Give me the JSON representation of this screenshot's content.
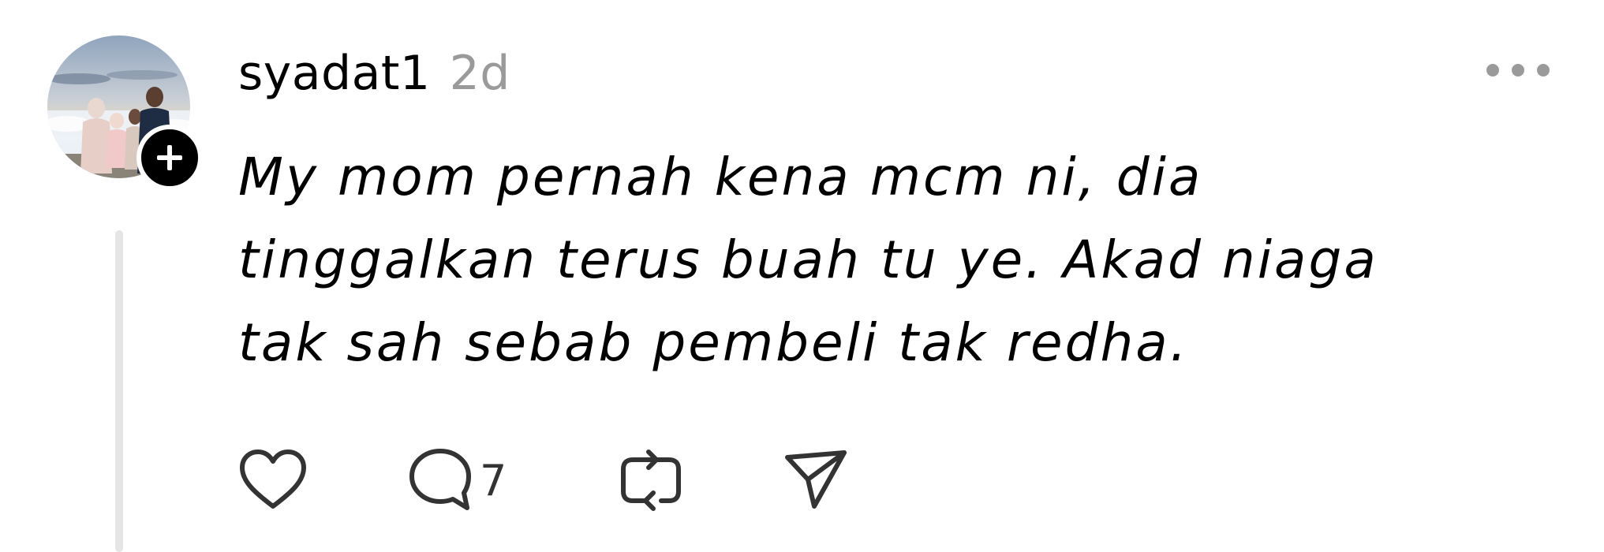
{
  "post": {
    "username": "syadat1",
    "timestamp": "2d",
    "text": "My mom pernah kena mcm ni, dia tinggalkan terus buah tu ye. Akad niaga tak sah sebab pembeli tak redha.",
    "reply_count": "7"
  },
  "icons": {
    "avatar": "profile-photo",
    "follow": "plus-icon",
    "more": "more-horizontal-icon",
    "like": "heart-icon",
    "reply": "comment-bubble-icon",
    "repost": "repost-icon",
    "share": "send-icon"
  },
  "colors": {
    "text": "#000000",
    "muted": "#9a9a9a",
    "thread_line": "#e5e5e5"
  }
}
